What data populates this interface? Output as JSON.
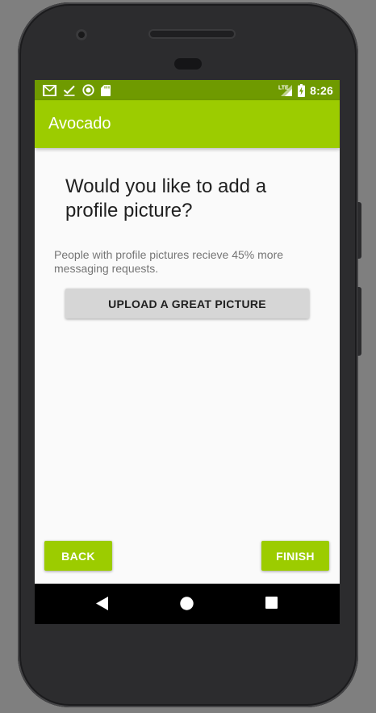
{
  "status_bar": {
    "time": "8:26",
    "network": "LTE",
    "left_icons": [
      "gmail-icon",
      "checkmark-icon",
      "sync-circle-icon",
      "sd-card-icon"
    ],
    "right_icons": [
      "signal-icon",
      "battery-charging-icon"
    ],
    "color": "#6f9a00"
  },
  "app_bar": {
    "title": "Avocado",
    "color": "#9ccc00"
  },
  "content": {
    "question": "Would you like to add a profile picture?",
    "description": "People with profile pictures recieve 45% more messaging requests.",
    "upload_label": "UPLOAD A GREAT PICTURE"
  },
  "footer": {
    "back_label": "BACK",
    "finish_label": "FINISH"
  },
  "nav_bar": {
    "keys": [
      "back-triangle-icon",
      "home-circle-icon",
      "recents-square-icon"
    ]
  }
}
